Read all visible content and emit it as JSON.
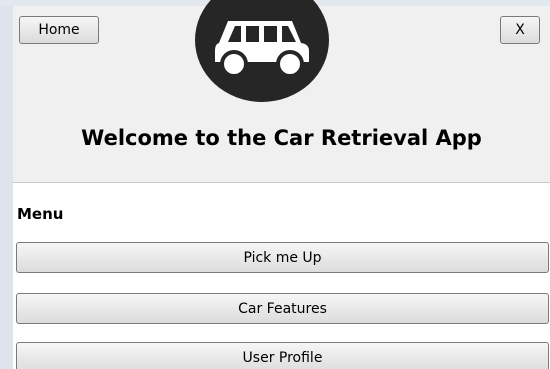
{
  "header": {
    "home_label": "Home",
    "close_label": "X",
    "title": "Welcome to the Car Retrieval App",
    "logo_icon": "car-icon",
    "logo_color": "#262626"
  },
  "menu": {
    "label": "Menu",
    "items": [
      {
        "label": "Pick me Up"
      },
      {
        "label": "Car Features"
      },
      {
        "label": "User Profile"
      }
    ]
  },
  "colors": {
    "header_bg": "#f0f0f0",
    "button_border": "#7a7a7a"
  }
}
